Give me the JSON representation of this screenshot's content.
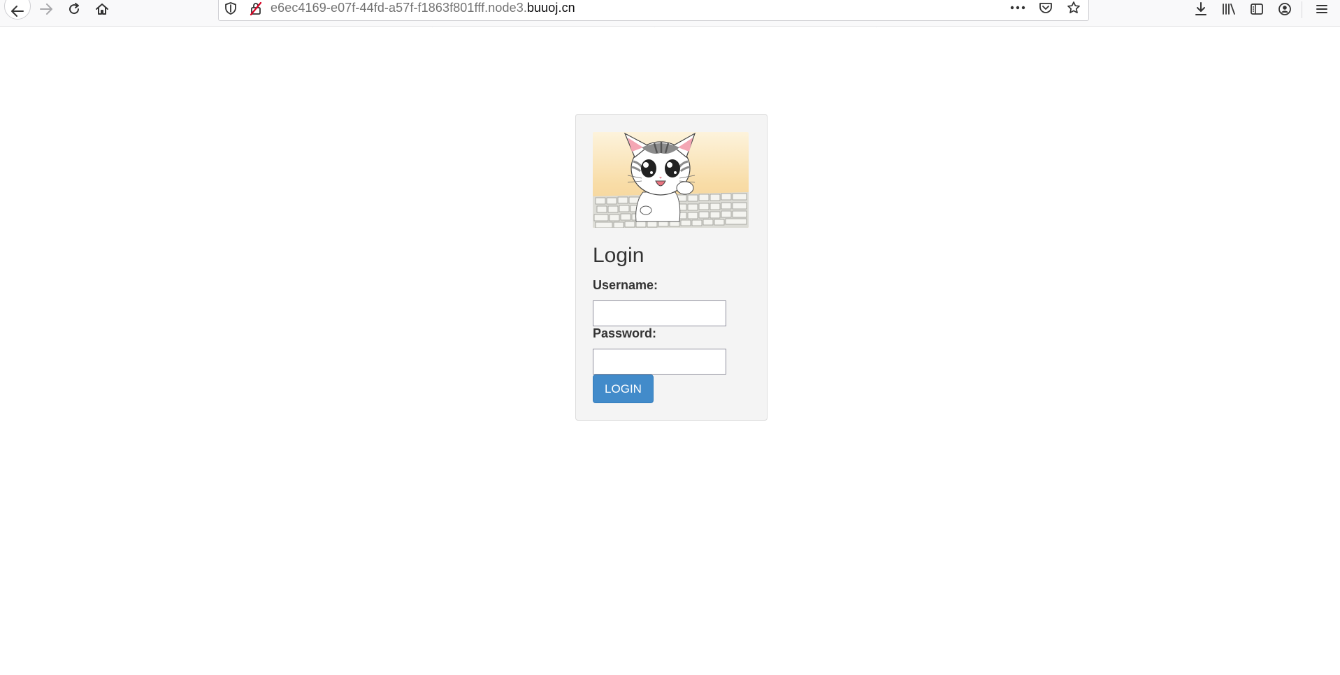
{
  "browser": {
    "url": {
      "prefix": "e6ec4169-e07f-44fd-a57f-f1863f801fff.node3.",
      "domain": "buuoj.cn"
    },
    "icons": {
      "back": "back-arrow-icon",
      "forward": "forward-arrow-icon",
      "reload": "reload-icon",
      "home": "home-icon",
      "tracking": "shield-icon",
      "insecure": "insecure-lock-icon",
      "page_actions": "more-dots-icon",
      "pocket": "pocket-icon",
      "bookmark": "star-icon",
      "downloads": "download-icon",
      "library": "library-icon",
      "sidebar": "sidebar-icon",
      "account": "account-icon",
      "menu": "hamburger-menu-icon"
    }
  },
  "login": {
    "title": "Login",
    "username_label": "Username:",
    "username_value": "",
    "password_label": "Password:",
    "password_value": "",
    "submit_label": "LOGIN"
  },
  "colors": {
    "button": "#428bca",
    "card_background": "#f4f4f4"
  }
}
